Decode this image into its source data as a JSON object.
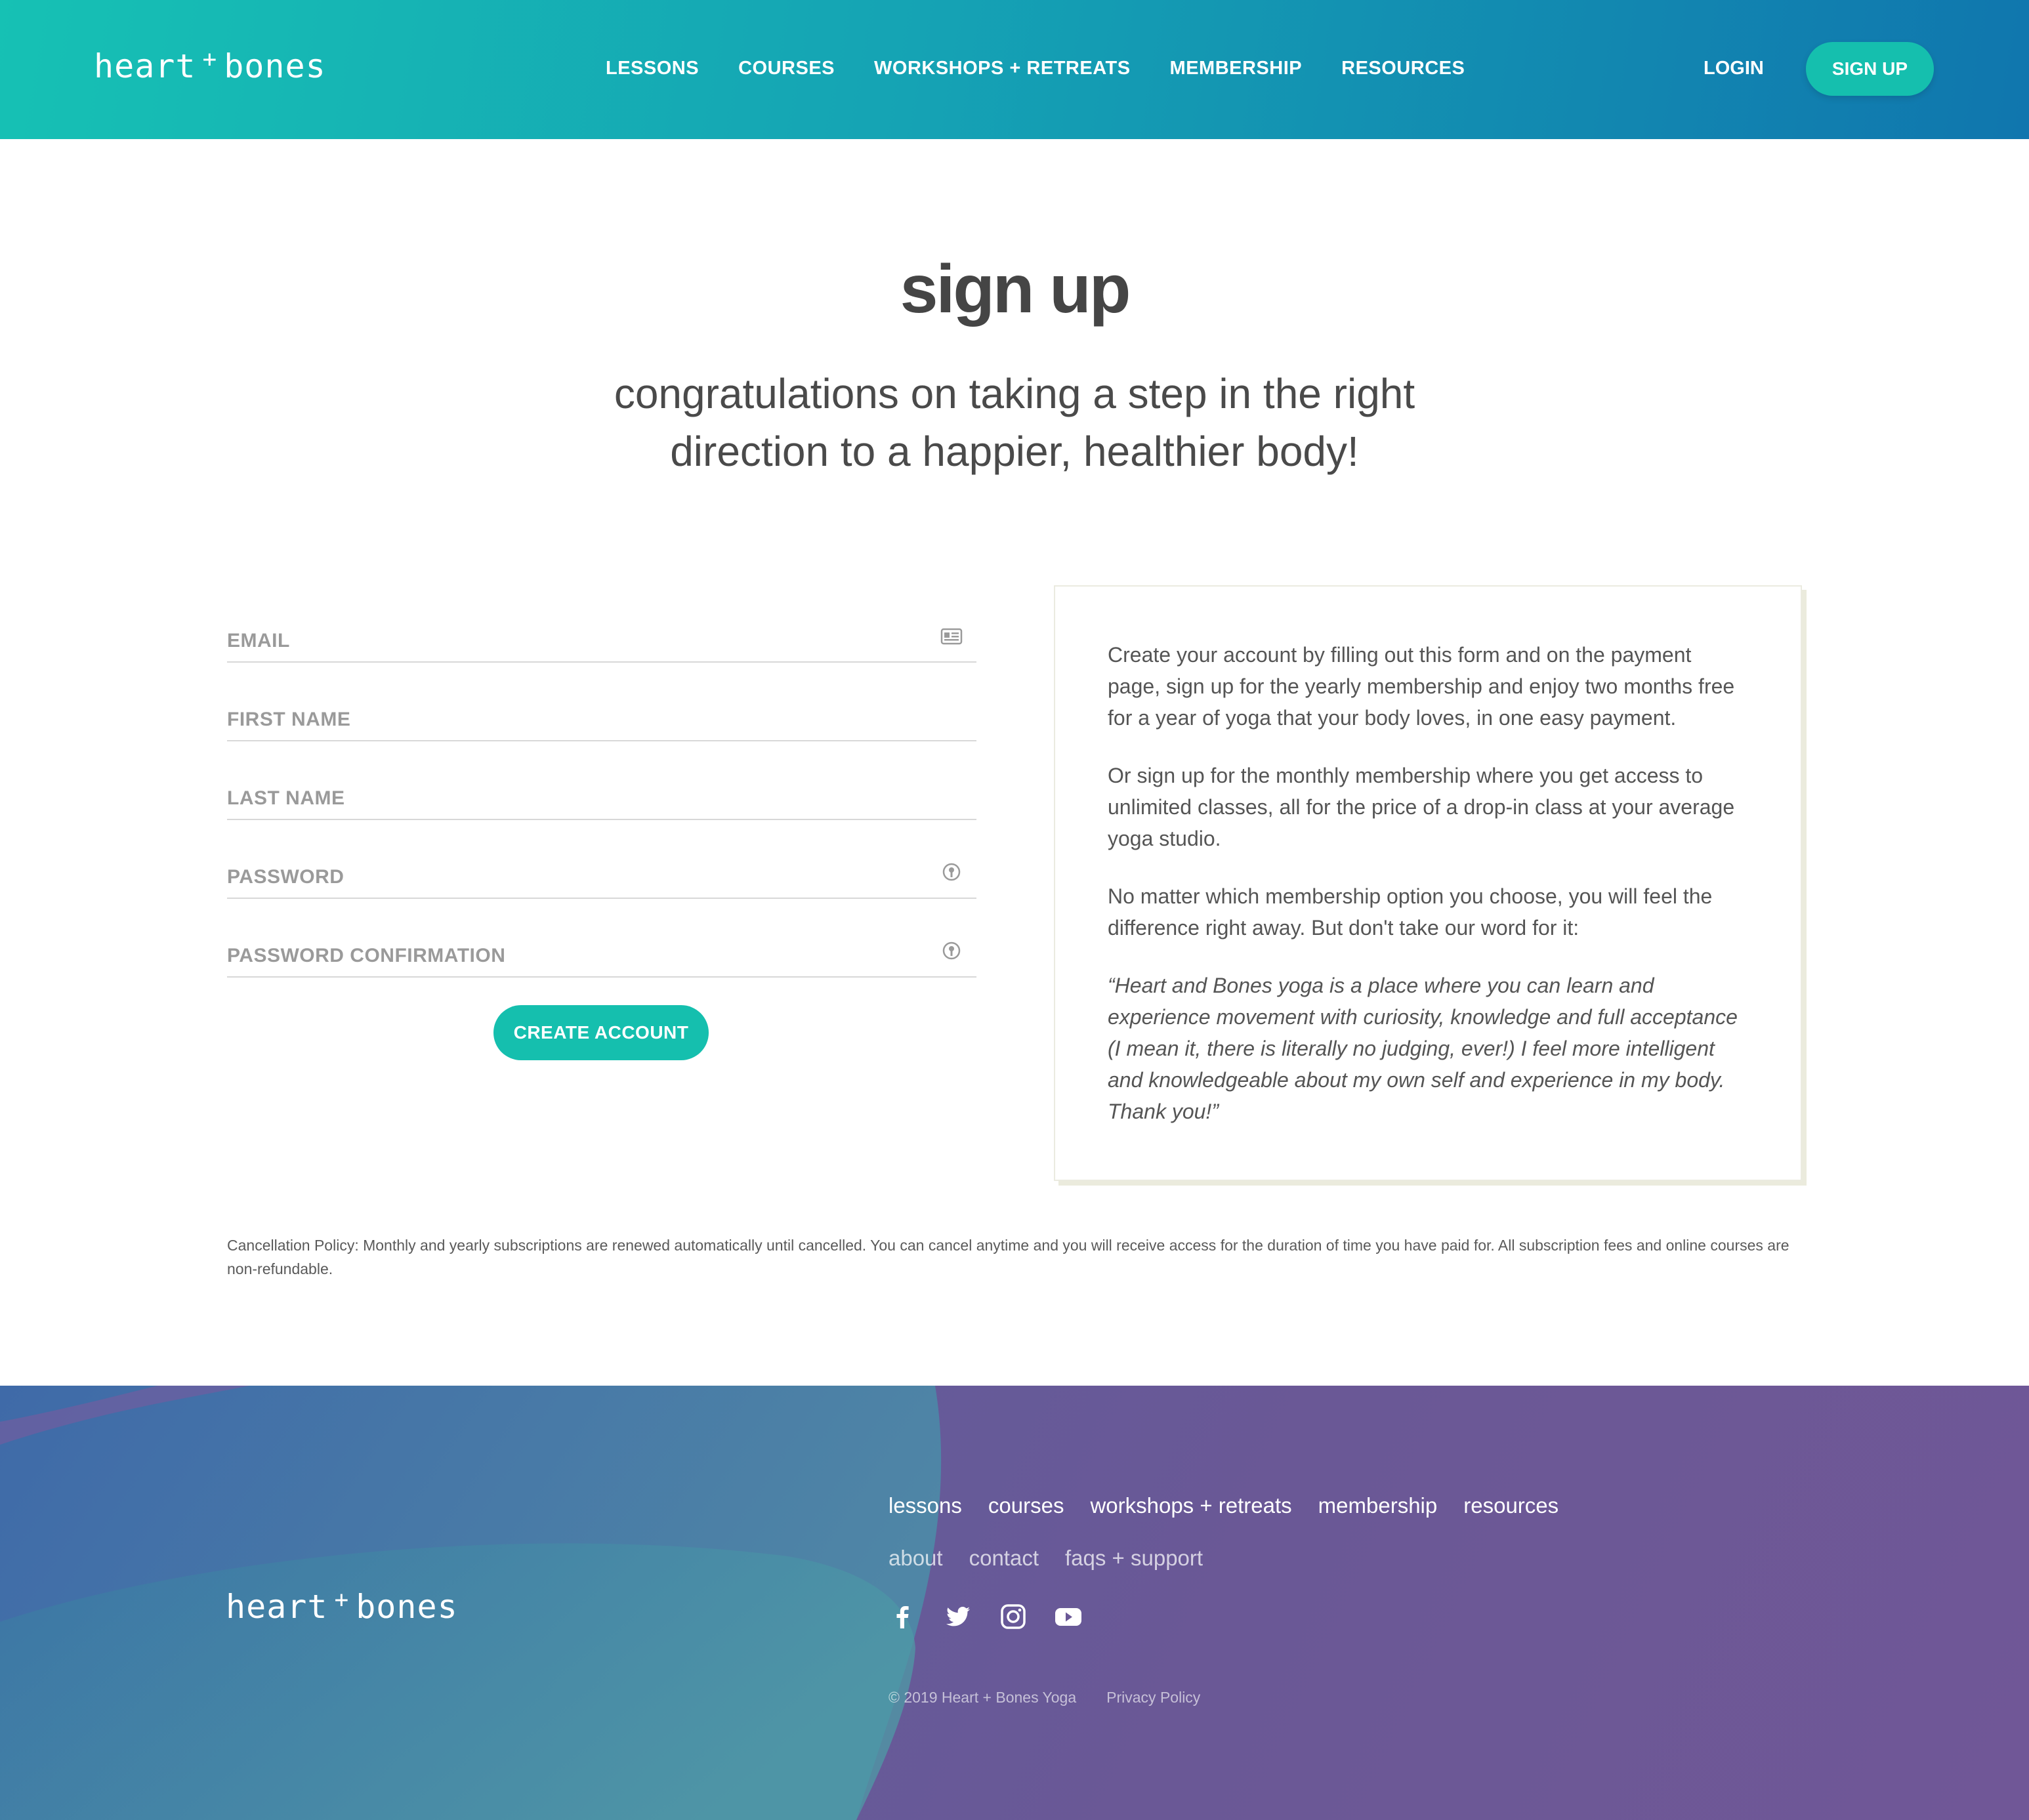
{
  "header": {
    "logo_left": "heart",
    "logo_plus": "+",
    "logo_right": "bones",
    "nav": [
      "LESSONS",
      "COURSES",
      "WORKSHOPS + RETREATS",
      "MEMBERSHIP",
      "RESOURCES"
    ],
    "login": "LOGIN",
    "signup": "SIGN UP"
  },
  "hero": {
    "title": "sign up",
    "subtitle": "congratulations on taking a step in the right direction to a happier, healthier body!"
  },
  "form": {
    "fields": [
      {
        "label": "EMAIL",
        "icon": "contact-card-icon"
      },
      {
        "label": "FIRST NAME",
        "icon": ""
      },
      {
        "label": "LAST NAME",
        "icon": ""
      },
      {
        "label": "PASSWORD",
        "icon": "password-manager-icon"
      },
      {
        "label": "PASSWORD CONFIRMATION",
        "icon": "password-manager-icon"
      }
    ],
    "submit": "CREATE ACCOUNT"
  },
  "card": {
    "p1": "Create your account by filling out this form and on the payment page, sign up for the yearly membership and enjoy two months free for a year of yoga that your body loves, in one easy payment.",
    "p2": "Or sign up for the monthly membership where you get access to unlimited classes, all for the price of a drop-in class at your average yoga studio.",
    "p3": "No matter which membership option you choose, you will feel the difference right away. But don't take our word for it:",
    "quote": "“Heart and Bones yoga is a place where you can learn and experience movement with curiosity, knowledge and full acceptance (I mean it, there is literally no judging, ever!) I feel more intelligent and knowledgeable about my own self and experience in my body. Thank you!”"
  },
  "policy": "Cancellation Policy: Monthly and yearly subscriptions are renewed automatically until cancelled. You can cancel anytime and you will receive access for the duration of time you have paid for. All subscription fees and online courses are non-refundable.",
  "footer": {
    "logo_left": "heart",
    "logo_plus": "+",
    "logo_right": "bones",
    "nav_primary": [
      "lessons",
      "courses",
      "workshops + retreats",
      "membership",
      "resources"
    ],
    "nav_secondary": [
      "about",
      "contact",
      "faqs + support"
    ],
    "social": [
      "facebook-icon",
      "twitter-icon",
      "instagram-icon",
      "youtube-icon"
    ],
    "copyright": "© 2019 Heart + Bones Yoga",
    "privacy": "Privacy Policy"
  },
  "colors": {
    "accent": "#15bfae",
    "header_start": "#16c1b4",
    "header_end": "#1076ae",
    "footer_purple": "#6a5896",
    "text": "#4a4a4a"
  }
}
